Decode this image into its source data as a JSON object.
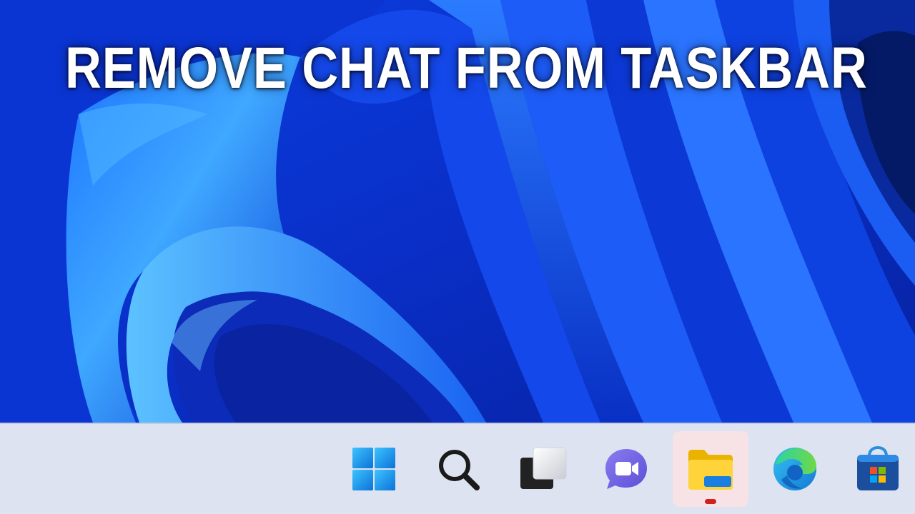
{
  "headline": "REMOVE CHAT FROM TASKBAR",
  "colors": {
    "wallpaper_dark": "#0726a8",
    "wallpaper_mid": "#1553ef",
    "wallpaper_light": "#3fa0ff",
    "taskbar_bg": "#dde3f0",
    "active_button_bg": "#f7e3e6",
    "running_indicator": "#d0211c"
  },
  "taskbar": {
    "items": [
      {
        "name": "Start",
        "icon": "windows-logo-icon",
        "active": false
      },
      {
        "name": "Search",
        "icon": "search-icon",
        "active": false
      },
      {
        "name": "Task View",
        "icon": "task-view-icon",
        "active": false
      },
      {
        "name": "Chat",
        "icon": "chat-video-icon",
        "active": false
      },
      {
        "name": "File Explorer",
        "icon": "folder-icon",
        "active": true
      },
      {
        "name": "Microsoft Edge",
        "icon": "edge-icon",
        "active": false
      },
      {
        "name": "Microsoft Store",
        "icon": "store-bag-icon",
        "active": false
      }
    ]
  }
}
